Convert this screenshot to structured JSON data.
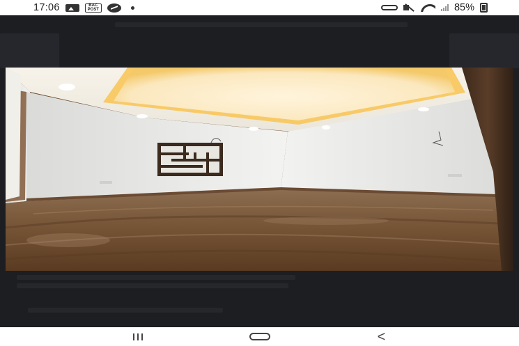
{
  "status_bar": {
    "time": "17:06",
    "bac_label": "BAC\nPOST",
    "battery_percent": "85%",
    "icons": [
      "gallery-icon",
      "bac-icon",
      "messenger-icon",
      "notification-dot-icon",
      "link-icon",
      "mute-icon",
      "wifi-icon",
      "signal-icon",
      "battery-icon"
    ]
  },
  "viewer": {
    "image_description_icon": "room-photo"
  },
  "navigation": {
    "recents_icon": "recents-icon",
    "home_icon": "home-icon",
    "back_icon": "back-icon",
    "back_glyph": "<"
  },
  "colors": {
    "overlay_bg": "#1d1e22",
    "status_bar_bg": "#ffffff",
    "nav_bar_bg": "#ffffff",
    "ceiling_glow": "#ffcf63",
    "floor_wood": "#7a5a3c"
  }
}
